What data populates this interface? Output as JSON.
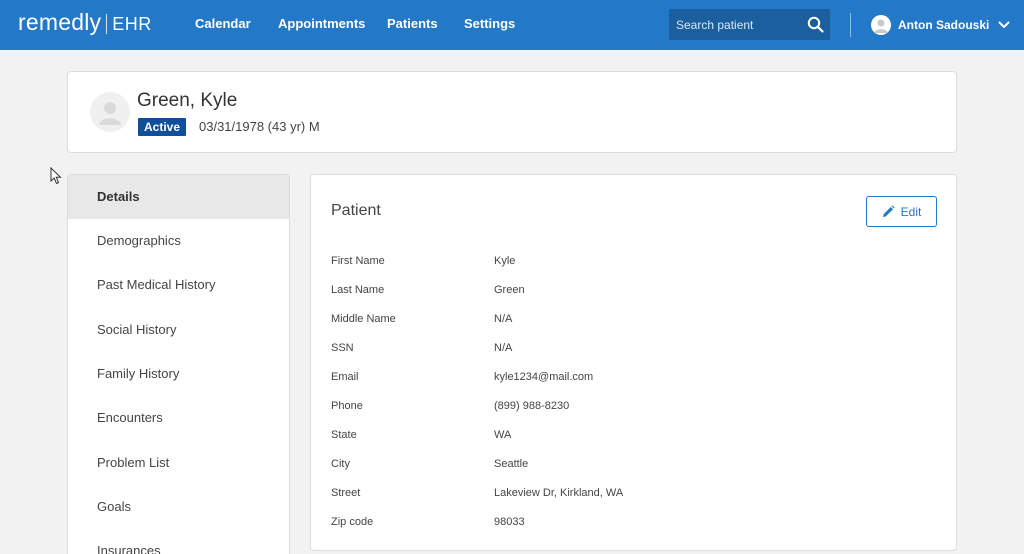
{
  "brand": {
    "name": "remedly",
    "product": "EHR"
  },
  "nav": [
    {
      "label": "Calendar"
    },
    {
      "label": "Appointments"
    },
    {
      "label": "Patients"
    },
    {
      "label": "Settings"
    }
  ],
  "search": {
    "placeholder": "Search patient",
    "icon": "search-icon"
  },
  "user": {
    "name": "Anton Sadouski",
    "icon": "chevron-down-icon"
  },
  "patient": {
    "name": "Green, Kyle",
    "status": "Active",
    "info": "03/31/1978 (43 yr) M",
    "status_color": "#0f4f9c"
  },
  "sidemenu": [
    {
      "label": "Details",
      "active": true
    },
    {
      "label": "Demographics"
    },
    {
      "label": "Past Medical History"
    },
    {
      "label": "Social History"
    },
    {
      "label": "Family History"
    },
    {
      "label": "Encounters"
    },
    {
      "label": "Problem List"
    },
    {
      "label": "Goals"
    },
    {
      "label": "Insurances"
    }
  ],
  "section": {
    "title": "Patient",
    "edit_label": "Edit"
  },
  "fields": [
    {
      "label": "First Name",
      "value": "Kyle"
    },
    {
      "label": "Last Name",
      "value": "Green"
    },
    {
      "label": "Middle Name",
      "value": "N/A"
    },
    {
      "label": "SSN",
      "value": "N/A"
    },
    {
      "label": "Email",
      "value": "kyle1234@mail.com"
    },
    {
      "label": "Phone",
      "value": "(899) 988-8230"
    },
    {
      "label": "State",
      "value": "WA"
    },
    {
      "label": "City",
      "value": "Seattle"
    },
    {
      "label": "Street",
      "value": "Lakeview Dr, Kirkland, WA"
    },
    {
      "label": "Zip code",
      "value": "98033"
    }
  ],
  "colors": {
    "nav_bg": "#2378c8",
    "accent": "#2378c8",
    "background": "#f2f2f2"
  }
}
